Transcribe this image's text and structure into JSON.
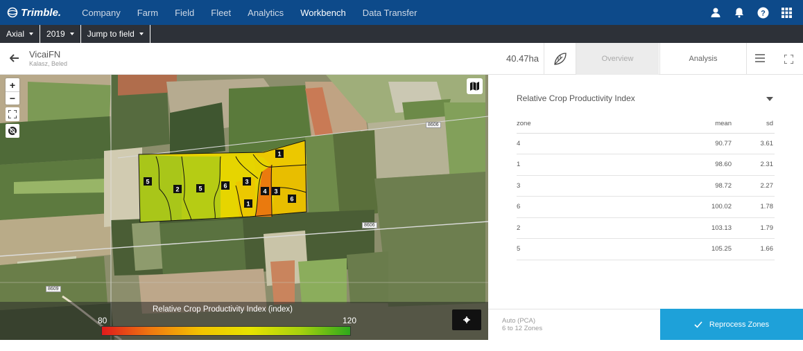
{
  "brand": "Trimble.",
  "nav": {
    "items": [
      "Company",
      "Farm",
      "Field",
      "Fleet",
      "Analytics",
      "Workbench",
      "Data Transfer"
    ],
    "active": "Workbench"
  },
  "subbar": {
    "org": "Axial",
    "year": "2019",
    "jump": "Jump to field"
  },
  "field": {
    "name": "VicaiFN",
    "subtitle": "Kalasz, Beled",
    "area": "40.47ha"
  },
  "tabs": {
    "overview": "Overview",
    "analysis": "Analysis"
  },
  "map": {
    "roads": [
      "8606",
      "8606",
      "8609"
    ],
    "zone_labels": [
      "5",
      "2",
      "5",
      "6",
      "3",
      "1",
      "4",
      "3",
      "1",
      "6"
    ],
    "legend": {
      "title": "Relative Crop Productivity Index (index)",
      "min": "80",
      "max": "120"
    }
  },
  "panel": {
    "layer": "Relative Crop Productivity Index",
    "columns": [
      "zone",
      "mean",
      "sd"
    ],
    "rows": [
      [
        "4",
        "90.77",
        "3.61"
      ],
      [
        "1",
        "98.60",
        "2.31"
      ],
      [
        "3",
        "98.72",
        "2.27"
      ],
      [
        "6",
        "100.02",
        "1.78"
      ],
      [
        "2",
        "103.13",
        "1.79"
      ],
      [
        "5",
        "105.25",
        "1.66"
      ]
    ]
  },
  "footer": {
    "method": "Auto (PCA)",
    "zones_range": "6  to  12  Zones",
    "reprocess": "Reprocess Zones"
  },
  "colors": {
    "nav_bg": "#0d4a8a",
    "subbar_bg": "#2d3138",
    "accent": "#1ea1d9"
  }
}
